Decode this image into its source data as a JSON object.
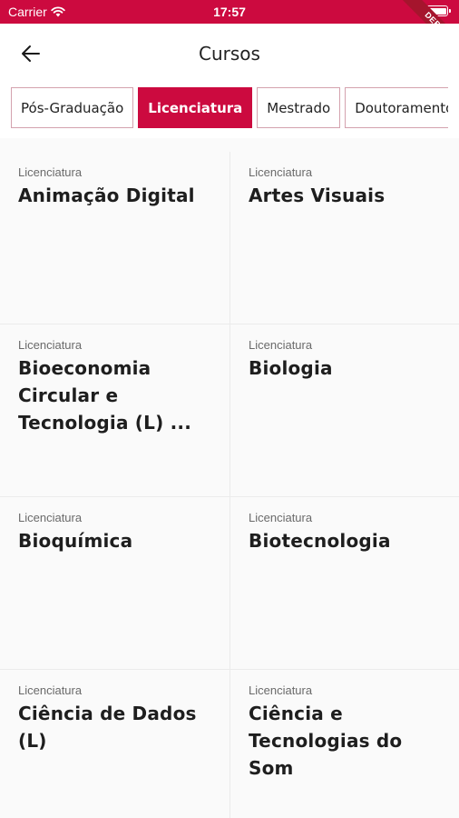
{
  "status_bar": {
    "carrier": "Carrier",
    "time": "17:57"
  },
  "debug_banner": "DEBUG",
  "header": {
    "title": "Cursos"
  },
  "tabs": [
    {
      "label": "Pós-Graduação",
      "active": false
    },
    {
      "label": "Licenciatura",
      "active": true
    },
    {
      "label": "Mestrado",
      "active": false
    },
    {
      "label": "Doutoramento",
      "active": false
    }
  ],
  "courses": [
    {
      "type": "Licenciatura",
      "name": "Animação Digital"
    },
    {
      "type": "Licenciatura",
      "name": "Artes Visuais"
    },
    {
      "type": "Licenciatura",
      "name": "Bioeconomia Circular e Tecnologia (L) ..."
    },
    {
      "type": "Licenciatura",
      "name": "Biologia"
    },
    {
      "type": "Licenciatura",
      "name": "Bioquímica"
    },
    {
      "type": "Licenciatura",
      "name": "Biotecnologia"
    },
    {
      "type": "Licenciatura",
      "name": "Ciência de Dados (L)"
    },
    {
      "type": "Licenciatura",
      "name": "Ciência e Tecnologias do Som"
    }
  ],
  "colors": {
    "accent": "#cc0a3f",
    "tab_border": "#d4a2ae",
    "background": "#fafafa"
  }
}
